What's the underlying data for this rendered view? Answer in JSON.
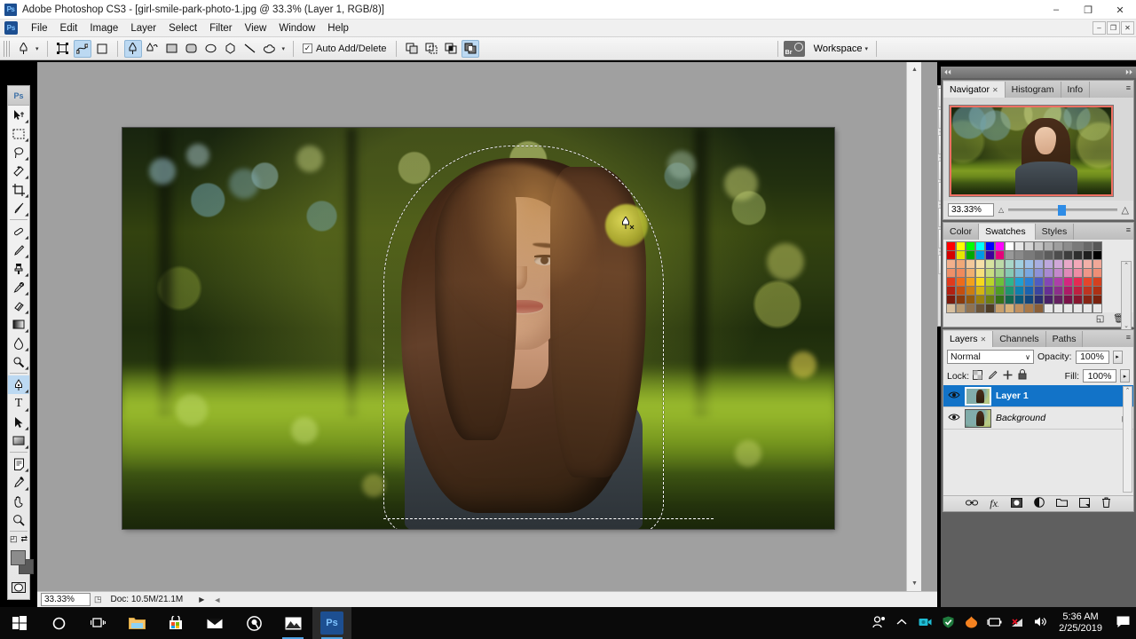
{
  "titlebar": {
    "app_icon": "ps-logo-icon",
    "title": "Adobe Photoshop CS3 - [girl-smile-park-photo-1.jpg @ 33.3% (Layer 1, RGB/8)]",
    "minimize": "–",
    "restore": "❐",
    "close": "✕"
  },
  "menubar": {
    "items": [
      "File",
      "Edit",
      "Image",
      "Layer",
      "Select",
      "Filter",
      "View",
      "Window",
      "Help"
    ],
    "doc_minimize": "–",
    "doc_restore": "❐",
    "doc_close": "✕"
  },
  "options_bar": {
    "active_tool_icon": "pen-tool-icon",
    "tool_preset_caret": "▾",
    "mode_shape_layers": "shape-layers-icon",
    "mode_paths": "paths-icon",
    "mode_fill_pixels": "fill-pixels-icon",
    "pen_tool": "pen-tool-icon",
    "freeform_pen_tool": "freeform-pen-tool-icon",
    "rectangle_tool": "rectangle-tool-icon",
    "rounded_rectangle_tool": "rounded-rectangle-tool-icon",
    "ellipse_tool": "ellipse-tool-icon",
    "polygon_tool": "polygon-tool-icon",
    "line_tool": "line-tool-icon",
    "custom_shape_tool": "custom-shape-tool-icon",
    "shape_caret": "▾",
    "auto_add_delete_label": "Auto Add/Delete",
    "auto_add_delete_checked": "✓",
    "path_add": "add-to-path-icon",
    "path_subtract": "subtract-from-path-icon",
    "path_intersect": "intersect-path-icon",
    "path_exclude": "exclude-path-icon",
    "bridge_icon": "go-to-bridge-icon",
    "workspace_label": "Workspace",
    "workspace_caret": "▾"
  },
  "toolbar": {
    "logo": "Ps",
    "groups": [
      [
        {
          "name": "move-tool",
          "glyph": "↖",
          "extra": "✥",
          "active": false
        },
        {
          "name": "rectangular-marquee-tool",
          "glyph": "⬚",
          "active": false
        },
        {
          "name": "lasso-tool",
          "glyph": "❀",
          "active": false
        },
        {
          "name": "magic-wand-tool",
          "glyph": "✳",
          "active": false
        },
        {
          "name": "crop-tool",
          "glyph": "⛏",
          "active": false
        },
        {
          "name": "eyedropper-slice-tool",
          "glyph": "✐",
          "active": false
        }
      ],
      [
        {
          "name": "healing-brush-tool",
          "glyph": "⚕",
          "active": false
        },
        {
          "name": "brush-tool",
          "glyph": "✎",
          "active": false
        },
        {
          "name": "clone-stamp-tool",
          "glyph": "⬛",
          "active": false
        },
        {
          "name": "history-brush-tool",
          "glyph": "✒",
          "active": false
        },
        {
          "name": "eraser-tool",
          "glyph": "▱",
          "active": false
        },
        {
          "name": "gradient-tool",
          "glyph": "▤",
          "active": false
        },
        {
          "name": "blur-tool",
          "glyph": "●",
          "active": false
        },
        {
          "name": "dodge-tool",
          "glyph": "⚲",
          "active": false
        }
      ],
      [
        {
          "name": "pen-tool",
          "glyph": "✒",
          "active": true
        },
        {
          "name": "type-tool",
          "glyph": "T",
          "active": false
        },
        {
          "name": "path-selection-tool",
          "glyph": "➤",
          "active": false
        },
        {
          "name": "rectangle-shape-tool",
          "glyph": "▬",
          "active": false
        }
      ],
      [
        {
          "name": "notes-tool",
          "glyph": "☰",
          "active": false
        },
        {
          "name": "eyedropper-tool",
          "glyph": "⚗",
          "active": false
        },
        {
          "name": "hand-tool",
          "glyph": "✋",
          "active": false
        },
        {
          "name": "zoom-tool",
          "glyph": "⚲",
          "active": false
        }
      ]
    ],
    "swap_colors": "⇄",
    "default_colors": "◰",
    "foreground_color": "#8c8c8c",
    "background_color": "#5a5a5a",
    "quick_mask": "▣"
  },
  "document": {
    "zoom_value": "33.33%",
    "doc_info": "Doc: 10.5M/21.1M",
    "status_arrow": "▶",
    "resize_grip": "◢",
    "scroll_up": "▲",
    "scroll_down": "▼",
    "scroll_left": "◀",
    "scroll_right": "▶"
  },
  "icon_dock": {
    "buttons": [
      {
        "name": "tool-presets-icon",
        "glyph": "⬚"
      },
      {
        "name": "brushes-icon",
        "glyph": "▶"
      },
      {
        "name": "clone-source-icon",
        "glyph": "✂"
      },
      {
        "name": "character-styles-icon",
        "glyph": "⚘"
      },
      {
        "name": "layer-comps-icon",
        "glyph": "⊞"
      },
      {
        "name": "character-icon",
        "glyph": "A"
      },
      {
        "name": "paragraph-icon",
        "glyph": "¶"
      },
      {
        "name": "info-panel-icon",
        "glyph": "☷"
      }
    ]
  },
  "navigator_panel": {
    "tabs": [
      {
        "label": "Navigator",
        "active": true,
        "closeable": true
      },
      {
        "label": "Histogram",
        "active": false,
        "closeable": false
      },
      {
        "label": "Info",
        "active": false,
        "closeable": false
      }
    ],
    "zoom_value": "33.33%",
    "zoom_out_icon": "△",
    "zoom_in_icon": "△",
    "menu_icon": "≡",
    "minimize_icon": "–",
    "close_icon": "✕"
  },
  "color_panel": {
    "tabs": [
      {
        "label": "Color",
        "active": false,
        "closeable": false
      },
      {
        "label": "Swatches",
        "active": true,
        "closeable": true
      },
      {
        "label": "Styles",
        "active": false,
        "closeable": false
      }
    ],
    "new_swatch_icon": "◱",
    "delete_swatch_icon": "Ὕ1",
    "menu_icon": "≡",
    "swatch_colors": [
      "#ff0000",
      "#ffff00",
      "#00ff00",
      "#00ffff",
      "#0000ff",
      "#ff00ff",
      "#ffffff",
      "#e6e6e6",
      "#d4d4d4",
      "#c2c2c2",
      "#b0b0b0",
      "#9e9e9e",
      "#8c8c8c",
      "#7a7a7a",
      "#686868",
      "#565656",
      "#d40000",
      "#e6e600",
      "#00a800",
      "#0099e6",
      "#3d0099",
      "#e6007a",
      "#999999",
      "#8a8a8a",
      "#7a7a7a",
      "#6b6b6b",
      "#5c5c5c",
      "#4d4d4d",
      "#3d3d3d",
      "#2e2e2e",
      "#1f1f1f",
      "#000000",
      "#f2b08c",
      "#f0a878",
      "#f2c89a",
      "#f5e0a8",
      "#d6e3a0",
      "#bcd9a8",
      "#a8d6c8",
      "#a0cfe0",
      "#9fc0e8",
      "#a8aee0",
      "#bda8dd",
      "#d0a8d8",
      "#e8a8c8",
      "#f2a8b8",
      "#f2b0a8",
      "#f0a898",
      "#ee9068",
      "#ef8a5c",
      "#f0b070",
      "#f7e07a",
      "#c9dd80",
      "#a5d18c",
      "#86c9b4",
      "#7fbcd8",
      "#7aa8e0",
      "#8e92d8",
      "#a98ad2",
      "#c489cc",
      "#e08ab8",
      "#ee8ca4",
      "#ef9688",
      "#ee8e76",
      "#e03a1c",
      "#ee6b1a",
      "#f2a11c",
      "#f7d81c",
      "#b9d42a",
      "#6dbf3a",
      "#2fb58c",
      "#1f9fd4",
      "#2a7fd4",
      "#4f5cc0",
      "#8347b5",
      "#ad3fa8",
      "#d4267f",
      "#e52a52",
      "#e5452a",
      "#d4401f",
      "#b22012",
      "#c44f10",
      "#cc7d12",
      "#d4b412",
      "#96b01c",
      "#4f9c24",
      "#1f9470",
      "#0f7fae",
      "#1a62ae",
      "#3a449e",
      "#662f94",
      "#8c2e8a",
      "#ad1a66",
      "#bf2040",
      "#bf3420",
      "#ad3014",
      "#7a1a0c",
      "#8a3a0c",
      "#93590e",
      "#9a800e",
      "#6b7d12",
      "#377018",
      "#14684e",
      "#0a5a7c",
      "#12467c",
      "#2a2f70",
      "#4a2168",
      "#642060",
      "#7a1248",
      "#87162e",
      "#872414",
      "#7a220e",
      "#d8c0a0",
      "#b89a72",
      "#8f7250",
      "#6b5438",
      "#4f3d26",
      "#c8a06c",
      "#d8b078",
      "#c09060",
      "#a87848",
      "#8a5f38",
      "#e8e8e8",
      "#e8e8e8",
      "#e8e8e8",
      "#e8e8e8",
      "#e8e8e8",
      "#e8e8e8"
    ]
  },
  "layers_panel": {
    "tabs": [
      {
        "label": "Layers",
        "active": true,
        "closeable": true
      },
      {
        "label": "Channels",
        "active": false,
        "closeable": false
      },
      {
        "label": "Paths",
        "active": false,
        "closeable": false
      }
    ],
    "blend_mode": "Normal",
    "blend_caret": "∨",
    "opacity_label": "Opacity:",
    "opacity_value": "100%",
    "fill_label": "Fill:",
    "fill_value": "100%",
    "lock_label": "Lock:",
    "lock_transparent_icon": "⌧",
    "lock_image_icon": "✎",
    "lock_position_icon": "✛",
    "lock_all_icon": "ὑ2",
    "spinner": "▸",
    "menu_icon": "≡",
    "layers": [
      {
        "name": "Layer 1",
        "visible": "◉",
        "selected": true,
        "locked": false,
        "italic": false
      },
      {
        "name": "Background",
        "visible": "◉",
        "selected": false,
        "locked": true,
        "italic": true,
        "lock_icon": "ὑ2"
      }
    ],
    "bottom_buttons": [
      {
        "name": "link-layers-button",
        "glyph": "⚭"
      },
      {
        "name": "layer-style-button",
        "glyph": "fx"
      },
      {
        "name": "add-layer-mask-button",
        "glyph": "▣"
      },
      {
        "name": "adjustment-layer-button",
        "glyph": "◑"
      },
      {
        "name": "new-group-button",
        "glyph": "▭"
      },
      {
        "name": "new-layer-button",
        "glyph": "◱"
      },
      {
        "name": "delete-layer-button",
        "glyph": "⌧"
      }
    ]
  },
  "taskbar": {
    "items": [
      {
        "name": "start-button",
        "glyph": "⊞"
      },
      {
        "name": "cortana-search-icon",
        "glyph": "○"
      },
      {
        "name": "task-view-icon",
        "glyph": "▥"
      },
      {
        "name": "file-explorer-icon",
        "glyph": "▰"
      },
      {
        "name": "microsoft-store-icon",
        "glyph": "▦"
      },
      {
        "name": "mail-icon",
        "glyph": "✉"
      },
      {
        "name": "app-icon",
        "glyph": "◎"
      },
      {
        "name": "photos-icon",
        "glyph": "⛰"
      },
      {
        "name": "photoshop-taskbar-icon",
        "glyph": "Ps"
      }
    ],
    "tray": [
      {
        "name": "people-icon",
        "glyph": "⚇"
      },
      {
        "name": "show-hidden-icons-icon",
        "glyph": "⌃"
      },
      {
        "name": "camera-icon",
        "glyph": "▣"
      },
      {
        "name": "security-shield-icon",
        "glyph": "⛨"
      },
      {
        "name": "antivirus-icon",
        "glyph": "▲"
      },
      {
        "name": "battery-icon",
        "glyph": "▭"
      },
      {
        "name": "network-disconnected-icon",
        "glyph": "◢"
      },
      {
        "name": "volume-icon",
        "glyph": "🔊"
      }
    ],
    "time": "5:36 AM",
    "date": "2/25/2019",
    "action_center_icon": "⬜"
  }
}
